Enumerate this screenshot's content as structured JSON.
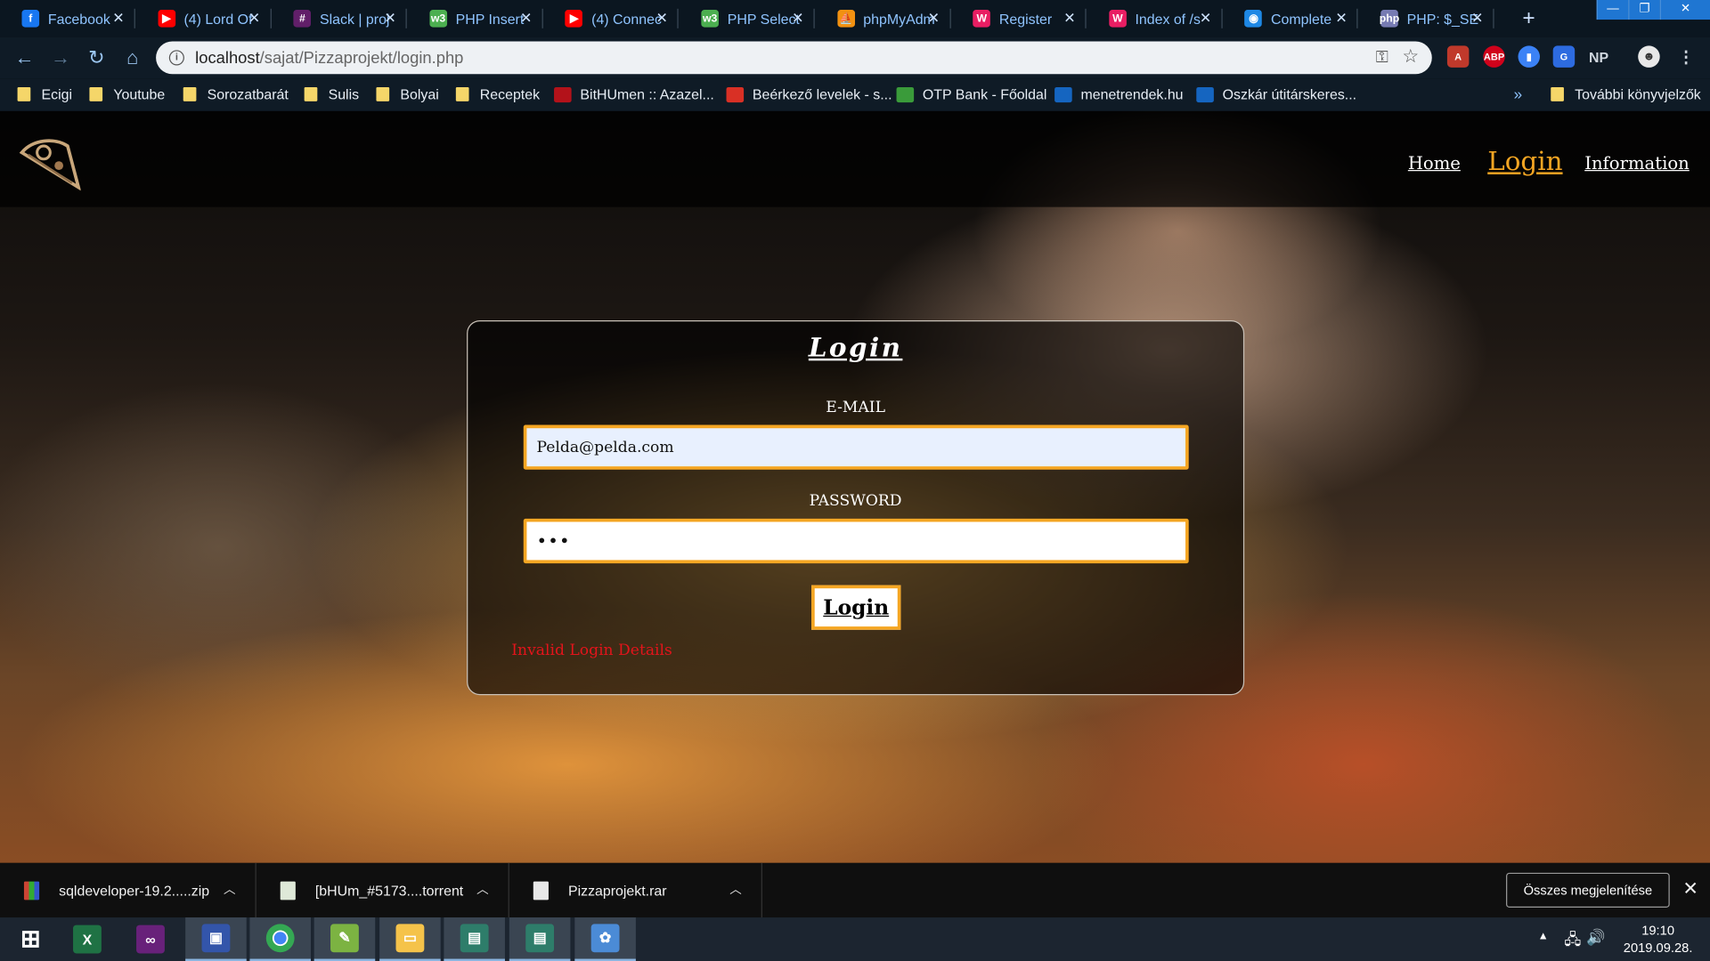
{
  "browser": {
    "tabs": [
      {
        "title": "Facebook",
        "icon": "facebook-icon",
        "color": "#1877f2",
        "glyph": "f"
      },
      {
        "title": "(4) Lord Of",
        "icon": "youtube-icon",
        "color": "#ff0000",
        "glyph": "▶"
      },
      {
        "title": "Slack | proj",
        "icon": "slack-icon",
        "color": "#611f69",
        "glyph": "#"
      },
      {
        "title": "PHP Insert",
        "icon": "w3schools-icon",
        "color": "#4caf50",
        "glyph": "w3"
      },
      {
        "title": "(4) Connec",
        "icon": "youtube-icon",
        "color": "#ff0000",
        "glyph": "▶"
      },
      {
        "title": "PHP Select",
        "icon": "w3schools-icon",
        "color": "#4caf50",
        "glyph": "w3"
      },
      {
        "title": "phpMyAdm",
        "icon": "phpmyadmin-icon",
        "color": "#f29111",
        "glyph": "⛵"
      },
      {
        "title": "Register",
        "icon": "localhost-icon",
        "color": "#e91e63",
        "glyph": "W"
      },
      {
        "title": "Index of /s",
        "icon": "localhost-icon",
        "color": "#e91e63",
        "glyph": "W"
      },
      {
        "title": "Complete",
        "icon": "globe-icon",
        "color": "#1e88e5",
        "glyph": "◉"
      },
      {
        "title": "PHP: $_SES",
        "icon": "php-icon",
        "color": "#777bb3",
        "glyph": "php"
      }
    ],
    "url_host": "localhost",
    "url_path": "/sajat/Pizzaprojekt/login.php",
    "extensions": [
      "pdf-icon",
      "adblock-icon",
      "bookmark-ext-icon",
      "translate-icon",
      "NP",
      "profile-icon"
    ],
    "bookmarks": [
      {
        "label": "Ecigi",
        "type": "folder"
      },
      {
        "label": "Youtube",
        "type": "folder"
      },
      {
        "label": "Sorozatbarát",
        "type": "folder"
      },
      {
        "label": "Sulis",
        "type": "folder"
      },
      {
        "label": "Bolyai",
        "type": "folder"
      },
      {
        "label": "Receptek",
        "type": "folder"
      },
      {
        "label": "BitHUmen :: Azazel...",
        "type": "site",
        "color": "#b3121a"
      },
      {
        "label": "Beérkező levelek - s...",
        "type": "site",
        "color": "#d93025"
      },
      {
        "label": "OTP Bank - Főoldal",
        "type": "site",
        "color": "#3a9b3a"
      },
      {
        "label": "menetrendek.hu",
        "type": "site",
        "color": "#1565c0"
      },
      {
        "label": "Oszkár útitárskeres...",
        "type": "site",
        "color": "#1565c0"
      }
    ],
    "other_bookmarks": "További könyvjelzők",
    "more_chevron": "»"
  },
  "site": {
    "nav": {
      "home": "Home",
      "login": "Login",
      "information": "Information"
    },
    "form": {
      "title": "Login",
      "email_label": "E-MAIL",
      "email_value": "Pelda@pelda.com",
      "password_label": "PASSWORD",
      "password_value": "•••",
      "submit": "Login",
      "error": "Invalid Login Details"
    },
    "accent": "#f5a623",
    "error_color": "#e3141b"
  },
  "downloads": {
    "items": [
      {
        "name": "sqldeveloper-19.2.....zip"
      },
      {
        "name": "[bHUm_#5173....torrent"
      },
      {
        "name": "Pizzaprojekt.rar"
      }
    ],
    "show_all": "Összes megjelenítése"
  },
  "taskbar": {
    "time": "19:10",
    "date": "2019.09.28."
  }
}
